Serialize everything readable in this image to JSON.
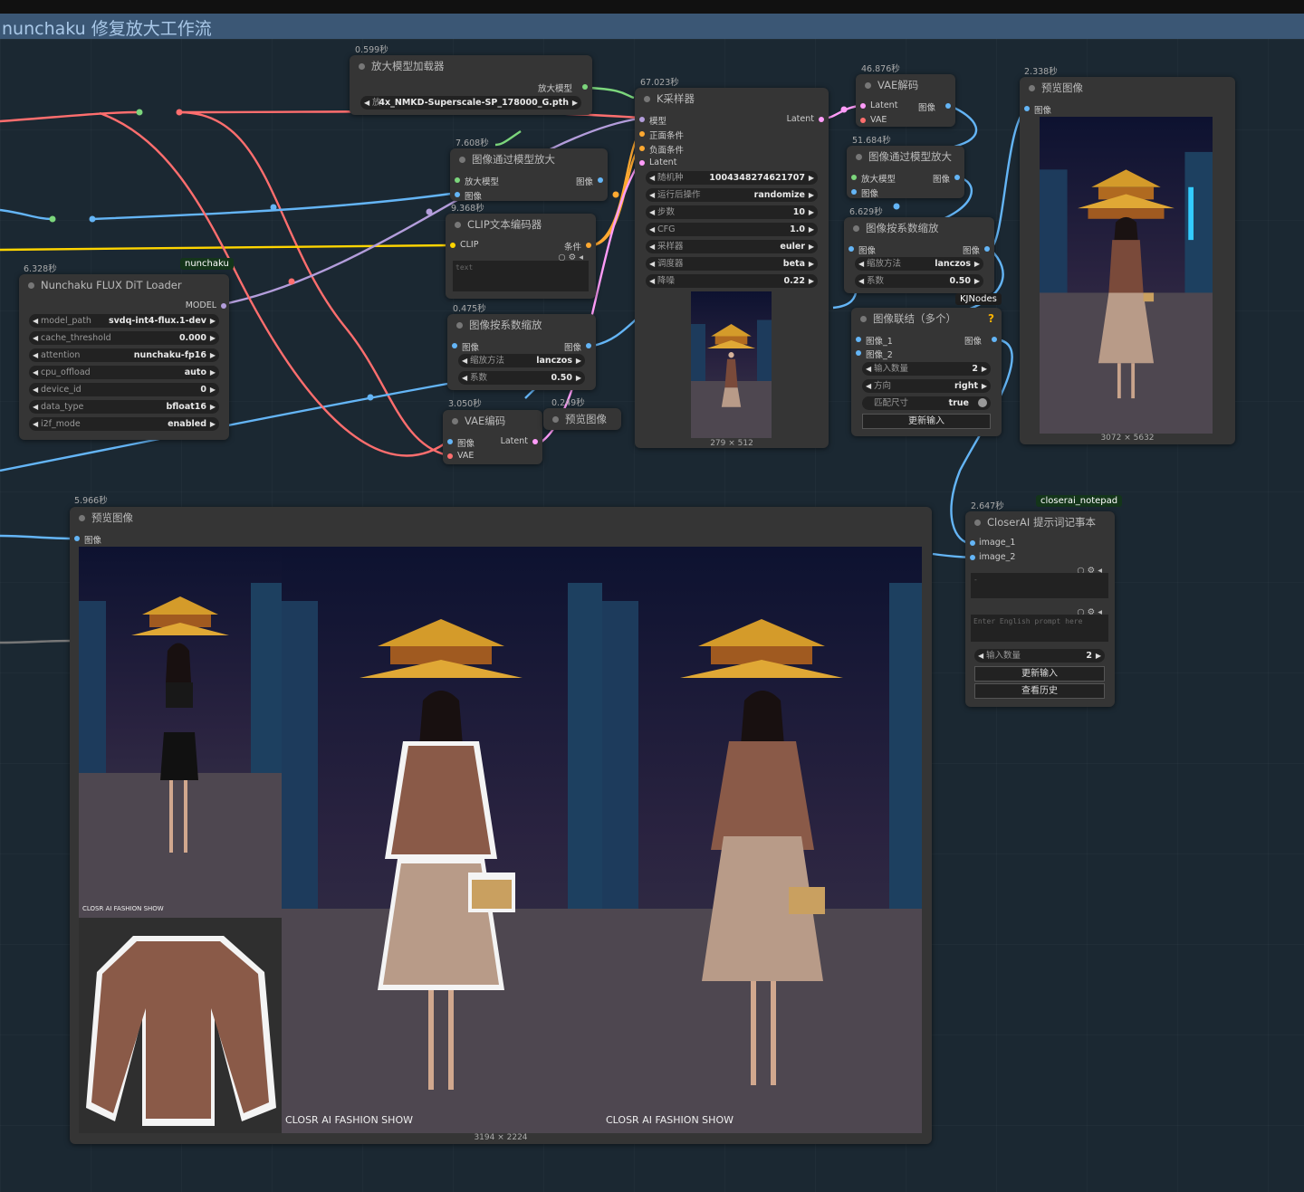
{
  "group_title": "nunchaku 修复放大工作流",
  "colors": {
    "model": "#b39ddb",
    "clip": "#ffd500",
    "cond": "#ffa931",
    "latent": "#ff9cf9",
    "image": "#64b5f6",
    "vae": "#ff6e6e",
    "upscale": "#7cd67c"
  },
  "nodes": {
    "upscale_loader": {
      "time": "0.599秒",
      "title": "放大模型加载器",
      "out": "放大模型",
      "widget_label": "放",
      "widget_value": "4x_NMKD-Superscale-SP_178000_G.pth"
    },
    "ksampler": {
      "time": "67.023秒",
      "title": "K采样器",
      "in_model": "模型",
      "in_pos": "正面条件",
      "in_neg": "负面条件",
      "in_latent": "Latent",
      "out_latent": "Latent",
      "widgets": [
        [
          "随机种",
          "1004348274621707"
        ],
        [
          "运行后操作",
          "randomize"
        ],
        [
          "步数",
          "10"
        ],
        [
          "CFG",
          "1.0"
        ],
        [
          "采样器",
          "euler"
        ],
        [
          "调度器",
          "beta"
        ],
        [
          "降噪",
          "0.22"
        ]
      ],
      "preview_size": "279 × 512"
    },
    "vae_decode": {
      "time": "46.876秒",
      "title": "VAE解码",
      "in_latent": "Latent",
      "in_vae": "VAE",
      "out": "图像"
    },
    "preview_right": {
      "time": "2.338秒",
      "title": "预览图像",
      "in": "图像",
      "size": "3072 × 5632"
    },
    "model_upscale_1": {
      "time": "7.608秒",
      "title": "图像通过模型放大",
      "in1": "放大模型",
      "in2": "图像",
      "out": "图像"
    },
    "model_upscale_2": {
      "time": "51.684秒",
      "title": "图像通过模型放大",
      "in1": "放大模型",
      "in2": "图像",
      "out": "图像"
    },
    "clip_encode": {
      "time": "9.368秒",
      "title": "CLIP文本编码器",
      "in": "CLIP",
      "out": "条件",
      "text": "text"
    },
    "scale_1": {
      "time": "0.475秒",
      "title": "图像按系数缩放",
      "in": "图像",
      "out": "图像",
      "widgets": [
        [
          "缩放方法",
          "lanczos"
        ],
        [
          "系数",
          "0.50"
        ]
      ]
    },
    "scale_2": {
      "time": "6.629秒",
      "title": "图像按系数缩放",
      "in": "图像",
      "out": "图像",
      "widgets": [
        [
          "缩放方法",
          "lanczos"
        ],
        [
          "系数",
          "0.50"
        ]
      ]
    },
    "vae_encode": {
      "time": "3.050秒",
      "title": "VAE编码",
      "in1": "图像",
      "in2": "VAE",
      "out": "Latent"
    },
    "small_preview": {
      "time": "0.249秒",
      "title": "预览图像"
    },
    "nunchaku": {
      "time": "6.328秒",
      "badge": "nunchaku",
      "title": "Nunchaku FLUX DiT Loader",
      "out": "MODEL",
      "widgets": [
        [
          "model_path",
          "svdq-int4-flux.1-dev"
        ],
        [
          "cache_threshold",
          "0.000"
        ],
        [
          "attention",
          "nunchaku-fp16"
        ],
        [
          "cpu_offload",
          "auto"
        ],
        [
          "device_id",
          "0"
        ],
        [
          "data_type",
          "bfloat16"
        ],
        [
          "i2f_mode",
          "enabled"
        ]
      ]
    },
    "concat": {
      "badge": "KJNodes",
      "title": "图像联结（多个）",
      "help": "?",
      "in1": "图像_1",
      "in2": "图像_2",
      "out": "图像",
      "widgets": [
        [
          "输入数量",
          "2"
        ],
        [
          "方向",
          "right"
        ]
      ],
      "match_label": "匹配尺寸",
      "match_value": "true",
      "button": "更新输入"
    },
    "preview_bottom": {
      "time": "5.966秒",
      "title": "预览图像",
      "in": "图像",
      "size": "3194 × 2224",
      "brand_text": "CLOSR AI FASHION SHOW",
      "brand_text2": "CLOSR AI FASHION SHOW"
    },
    "notepad": {
      "time": "2.647秒",
      "badge": "closerai_notepad",
      "title": "CloserAI 提示词记事本",
      "in1": "image_1",
      "in2": "image_2",
      "text1": "-",
      "text2": "Enter English prompt here",
      "widget_label": "输入数量",
      "widget_value": "2",
      "btn1": "更新输入",
      "btn2": "查看历史"
    }
  }
}
